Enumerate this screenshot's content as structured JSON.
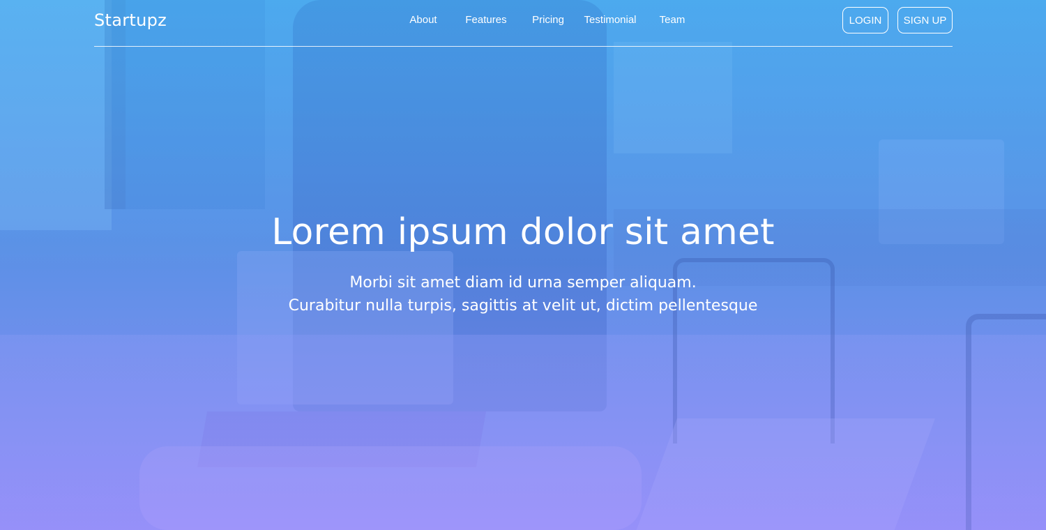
{
  "brand": "Startupz",
  "nav": {
    "about": "About",
    "features": "Features",
    "pricing": "Pricing",
    "testimonial": "Testimonial",
    "team": "Team"
  },
  "auth": {
    "login": "LOGIN",
    "signup": "SIGN UP"
  },
  "hero": {
    "title": "Lorem ipsum dolor sit amet",
    "subtitle_line1": "Morbi sit amet diam id urna semper aliquam.",
    "subtitle_line2": "Curabitur nulla turpis, sagittis at velit ut, dictim pellentesque"
  },
  "colors": {
    "gradient_top": "#4fa9ec",
    "gradient_bottom": "#8c8cf4",
    "text": "#ffffff"
  },
  "icons": {
    "background": "office-photo"
  }
}
